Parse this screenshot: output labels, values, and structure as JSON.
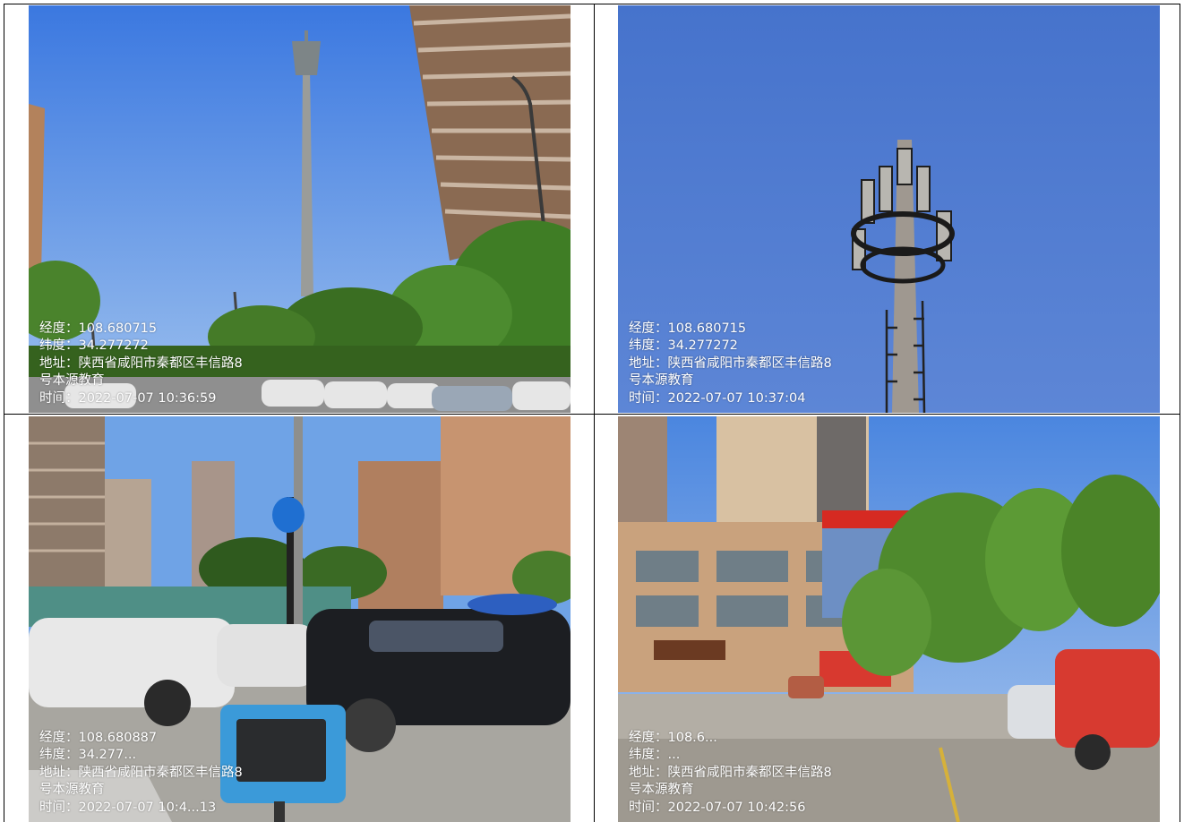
{
  "photos": [
    {
      "scene": "cell-tower-street-view",
      "watermark": {
        "longitude": "经度：108.680715",
        "latitude": "纬度：34.277272",
        "address": "地址：陕西省咸阳市秦都区丰信路8",
        "address2": "号本源教育",
        "time": "时间：2022-07-07 10:36:59"
      }
    },
    {
      "scene": "cell-tower-antennas",
      "watermark": {
        "longitude": "经度：108.680715",
        "latitude": "纬度：34.277272",
        "address": "地址：陕西省咸阳市秦都区丰信路8",
        "address2": "号本源教育",
        "time": "时间：2022-07-07 10:37:04"
      }
    },
    {
      "scene": "signal-tester-parking-lot",
      "watermark": {
        "longitude": "经度：108.680887",
        "latitude": "纬度：34.277...",
        "address": "地址：陕西省咸阳市秦都区丰信路8",
        "address2": "号本源教育",
        "time": "时间：2022-07-07 10:4...13"
      }
    },
    {
      "scene": "building-and-parking",
      "watermark": {
        "longitude": "经度：108.6...",
        "latitude": "纬度：...",
        "address": "地址：陕西省咸阳市秦都区丰信路8",
        "address2": "号本源教育",
        "time": "时间：2022-07-07 10:42:56"
      }
    }
  ],
  "colors": {
    "sky": "#3f7ce6",
    "sky_deep": "#4a73c9",
    "tree": "#4f8a2d",
    "building": "#b08a6b",
    "text": "#ffffff"
  }
}
